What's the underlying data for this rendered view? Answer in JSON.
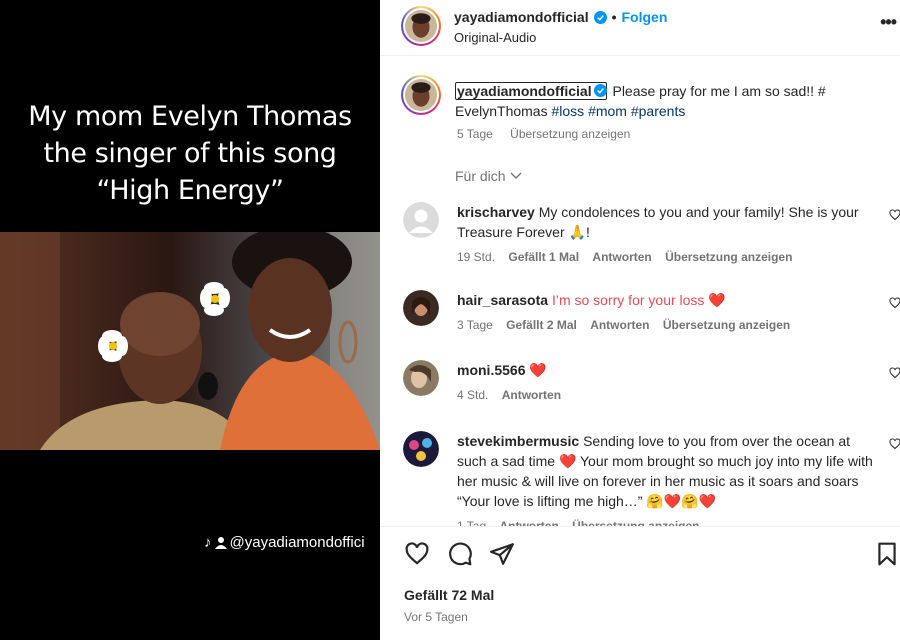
{
  "media": {
    "caption_lines": [
      "My mom Evelyn Thomas",
      "the singer of this song",
      "“High Energy”"
    ],
    "watermark": "@yayadiamondoffici"
  },
  "header": {
    "username": "yayadiamondofficial",
    "separator": "•",
    "follow_label": "Folgen",
    "audio": "Original-Audio",
    "more_icon": "more-horizontal-icon",
    "more_glyph": "•••"
  },
  "post_caption": {
    "username": "yayadiamondofficial",
    "text": "Please pray for me I am so sad!! #",
    "line2_text": "EvelynThomas ",
    "tags": [
      "#loss",
      "#mom",
      "#parents"
    ],
    "time": "5 Tage",
    "translate": "Übersetzung anzeigen"
  },
  "sort_label": "Für dich",
  "comments": [
    {
      "username": "krischarvey",
      "text": "My condolences to you and your family! She is your Treasure Forever 🙏!",
      "time": "19 Std.",
      "likes": "Gefällt 1 Mal",
      "reply": "Antworten",
      "translate": "Übersetzung anzeigen"
    },
    {
      "username": "hair_sarasota",
      "text": "I’m so sorry for your loss ❤️",
      "time": "3 Tage",
      "likes": "Gefällt 2 Mal",
      "reply": "Antworten",
      "translate": "Übersetzung anzeigen"
    },
    {
      "username": "moni.5566",
      "text": "❤️",
      "time": "4 Std.",
      "reply": "Antworten"
    },
    {
      "username": "stevekimbermusic",
      "text": "Sending love to you from over the ocean at such a sad time ❤️ Your mom brought so much joy into my life with her music & will live on forever in her music as it soars and soars “Your love is lifting me high…” 🤗❤️🤗❤️",
      "time": "1 Tag",
      "reply": "Antworten",
      "translate": "Übersetzung anzeigen"
    }
  ],
  "footer": {
    "likes": "Gefällt 72 Mal",
    "date": "Vor 5 Tagen"
  },
  "colors": {
    "accent": "#0095f6",
    "hashtag": "#00376b",
    "heart_red": "#ed4956",
    "verified": "#0095f6"
  }
}
